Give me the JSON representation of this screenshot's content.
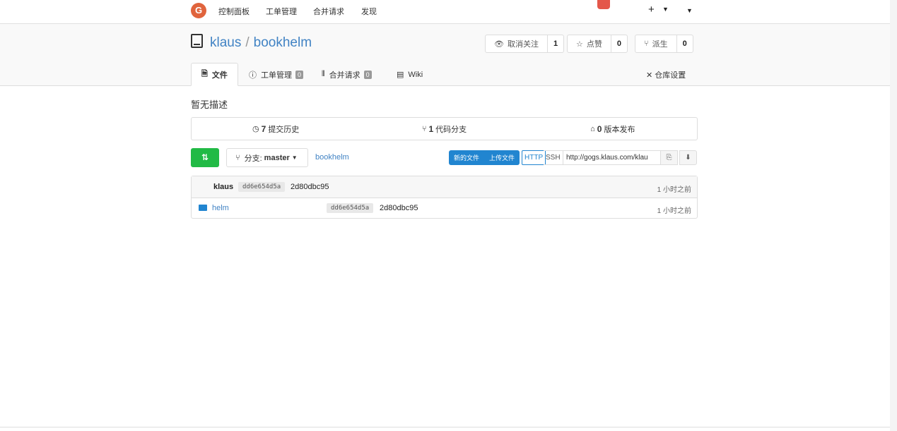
{
  "nav": {
    "logo_letter": "G",
    "items": [
      "控制面板",
      "工单管理",
      "合并请求",
      "发现"
    ],
    "plus": "+"
  },
  "repo": {
    "owner": "klaus",
    "name": "bookhelm",
    "separator": "/",
    "watch": {
      "label": "取消关注",
      "count": "1"
    },
    "star": {
      "label": "点赞",
      "count": "0"
    },
    "fork": {
      "label": "派生",
      "count": "0"
    }
  },
  "tabs": [
    {
      "label": "文件",
      "badge": ""
    },
    {
      "label": "工单管理",
      "badge": "0"
    },
    {
      "label": "合并请求",
      "badge": "0"
    },
    {
      "label": "Wiki",
      "badge": ""
    }
  ],
  "settings_label": "仓库设置",
  "description": "暂无描述",
  "stats": {
    "commits": {
      "count": "7",
      "label": "提交历史"
    },
    "branches": {
      "count": "1",
      "label": "代码分支"
    },
    "releases": {
      "count": "0",
      "label": "版本发布"
    }
  },
  "toolbar": {
    "branch_prefix": "分支:",
    "branch": "master",
    "breadcrumb": "bookhelm",
    "new_file": "新的文件",
    "upload_file": "上传文件",
    "http": "HTTP",
    "ssh": "SSH",
    "clone_url": "http://gogs.klaus.com/klau"
  },
  "latest_commit": {
    "author": "klaus",
    "sha": "dd6e654d5a",
    "message": "2d80dbc95",
    "time": "1 小时之前"
  },
  "files": [
    {
      "name": "helm",
      "sha": "dd6e654d5a",
      "message": "2d80dbc95",
      "time": "1 小时之前"
    }
  ]
}
